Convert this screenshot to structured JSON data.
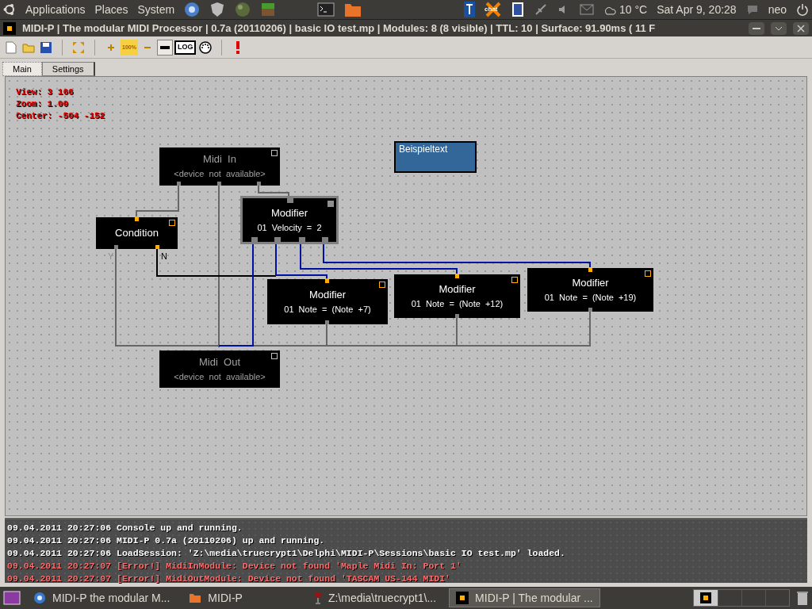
{
  "top_panel": {
    "menus": [
      "Applications",
      "Places",
      "System"
    ],
    "tray_chat": "chat",
    "weather": "10 °C",
    "clock": "Sat Apr 9, 20:28",
    "user": "neo"
  },
  "window": {
    "title": "MIDI-P | The modular MIDI Processor | 0.7a (20110206) | basic IO test.mp | Modules: 8 (8 visible) | TTL: 10 | Surface: 91.90ms ( 11 F"
  },
  "toolbar": [
    {
      "kind": "new"
    },
    {
      "kind": "open"
    },
    {
      "kind": "save"
    },
    {
      "kind": "sep"
    },
    {
      "kind": "fit"
    },
    {
      "kind": "sep"
    },
    {
      "kind": "zoom-in"
    },
    {
      "kind": "zoom-reset",
      "label": "100%"
    },
    {
      "kind": "zoom-out"
    },
    {
      "kind": "toggle",
      "selected": true
    },
    {
      "kind": "log",
      "label": "LOG",
      "selected": false
    },
    {
      "kind": "midi"
    },
    {
      "kind": "sep"
    },
    {
      "kind": "alert"
    }
  ],
  "tabs": [
    {
      "label": "Main",
      "selected": true
    },
    {
      "label": "Settings",
      "selected": false
    }
  ],
  "canvas": {
    "info": [
      "View: 3 166",
      "Zoom: 1.00",
      "Center: -504 -152"
    ],
    "nodes": [
      {
        "kind": "module",
        "title": "Midi  In",
        "subtitle": "<device  not  available>",
        "disabled": true,
        "selected": false
      },
      {
        "kind": "label",
        "title": "Beispieltext"
      },
      {
        "kind": "module",
        "title": "Condition",
        "disabled": false,
        "selected": false,
        "outputs": [
          "Y",
          "N"
        ]
      },
      {
        "kind": "module",
        "title": "Modifier",
        "subtitle": "01  Velocity  =  2",
        "disabled": false,
        "selected": true
      },
      {
        "kind": "module",
        "title": "Modifier",
        "subtitle": "01  Note  =  (Note  +7)",
        "disabled": false,
        "selected": false
      },
      {
        "kind": "module",
        "title": "Modifier",
        "subtitle": "01  Note  =  (Note  +12)",
        "disabled": false,
        "selected": false
      },
      {
        "kind": "module",
        "title": "Modifier",
        "subtitle": "01  Note  =  (Note  +19)",
        "disabled": false,
        "selected": false
      },
      {
        "kind": "module",
        "title": "Midi  Out",
        "subtitle": "<device  not  available>",
        "disabled": true,
        "selected": false
      }
    ]
  },
  "console": [
    {
      "kind": "info",
      "text": "09.04.2011 20:27:06 Console up and running."
    },
    {
      "kind": "info",
      "text": "09.04.2011 20:27:06 MIDI-P 0.7a (20110206) up and running."
    },
    {
      "kind": "info",
      "text": "09.04.2011 20:27:06 LoadSession: 'Z:\\media\\truecrypt1\\Delphi\\MIDI-P\\Sessions\\basic IO test.mp' loaded."
    },
    {
      "kind": "error",
      "text": "09.04.2011 20:27:07 [Error!] MidiInModule: Device not found 'Maple Midi In: Port 1'"
    },
    {
      "kind": "error",
      "text": "09.04.2011 20:27:07 [Error!] MidiOutModule: Device not found 'TASCAM US-144 MIDI'"
    }
  ],
  "taskbar": [
    {
      "kind": "browser",
      "label": "MIDI-P the modular M...",
      "selected": false
    },
    {
      "kind": "folder",
      "label": "MIDI-P",
      "selected": false
    },
    {
      "kind": "wine",
      "label": "Z:\\media\\truecrypt1\\...",
      "selected": false
    },
    {
      "kind": "app",
      "label": "MIDI-P | The modular ...",
      "selected": true
    }
  ]
}
